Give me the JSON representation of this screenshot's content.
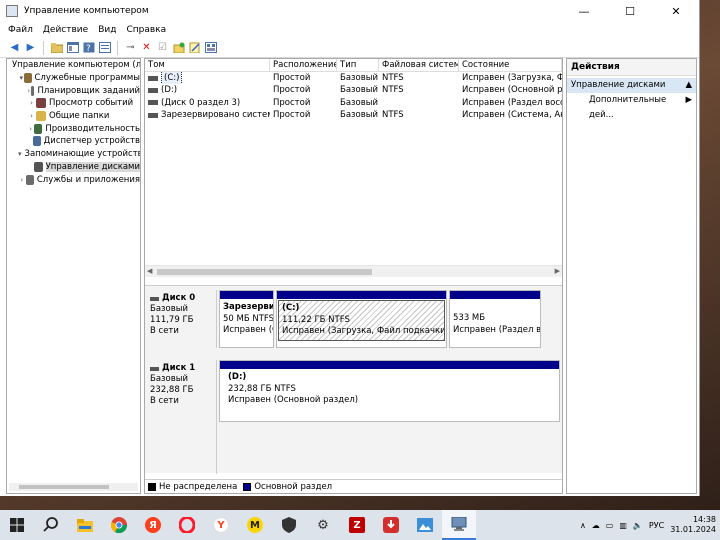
{
  "window": {
    "title": "Управление компьютером",
    "controls": [
      "—",
      "☐",
      "✕"
    ]
  },
  "menu": [
    "Файл",
    "Действие",
    "Вид",
    "Справка"
  ],
  "tree": {
    "items": [
      {
        "label": "Управление компьютером (лс",
        "indent": 0,
        "arrow": "",
        "color": "#5a7fa8"
      },
      {
        "label": "Служебные программы",
        "indent": 1,
        "arrow": "▾",
        "color": "#8a6d3b"
      },
      {
        "label": "Планировщик заданий",
        "indent": 2,
        "arrow": "›",
        "color": "#6b6b6b"
      },
      {
        "label": "Просмотр событий",
        "indent": 2,
        "arrow": "›",
        "color": "#7a3f3f"
      },
      {
        "label": "Общие папки",
        "indent": 2,
        "arrow": "›",
        "color": "#d8b24a"
      },
      {
        "label": "Производительность",
        "indent": 2,
        "arrow": "›",
        "color": "#3f6b3f"
      },
      {
        "label": "Диспетчер устройств",
        "indent": 2,
        "arrow": "",
        "color": "#4a6a9a"
      },
      {
        "label": "Запоминающие устройств",
        "indent": 1,
        "arrow": "▾",
        "color": "#6b6b6b"
      },
      {
        "label": "Управление дисками",
        "indent": 2,
        "arrow": "",
        "color": "#555555",
        "selected": true
      },
      {
        "label": "Службы и приложения",
        "indent": 1,
        "arrow": "›",
        "color": "#6b6b6b"
      }
    ]
  },
  "volumes": {
    "headers": [
      "Том",
      "Расположение",
      "Тип",
      "Файловая система",
      "Состояние"
    ],
    "rows": [
      {
        "name": "(C:)",
        "layout": "Простой",
        "type": "Базовый",
        "fs": "NTFS",
        "status": "Исправен (Загрузка, Файл",
        "selected": true
      },
      {
        "name": "(D:)",
        "layout": "Простой",
        "type": "Базовый",
        "fs": "NTFS",
        "status": "Исправен (Основной разде"
      },
      {
        "name": "(Диск 0 раздел 3)",
        "layout": "Простой",
        "type": "Базовый",
        "fs": "",
        "status": "Исправен (Раздел восстан"
      },
      {
        "name": "Зарезервировано системой",
        "layout": "Простой",
        "type": "Базовый",
        "fs": "NTFS",
        "status": "Исправен (Система, Актив"
      }
    ]
  },
  "disks": [
    {
      "name": "Диск 0",
      "type": "Базовый",
      "size": "111,79 ГБ",
      "state": "В сети",
      "partitions": [
        {
          "title": "Зарезервир",
          "line2": "50 МБ NTFS",
          "line3": "Исправен (С"
        },
        {
          "title": "(C:)",
          "line2": "111,22 ГБ NTFS",
          "line3": "Исправен (Загрузка, Файл подкачки, Авар"
        },
        {
          "title": "",
          "line2": "533 МБ",
          "line3": "Исправен (Раздел вос"
        }
      ]
    },
    {
      "name": "Диск 1",
      "type": "Базовый",
      "size": "232,88 ГБ",
      "state": "В сети",
      "partitions": [
        {
          "title": "(D:)",
          "line2": "232,88 ГБ NTFS",
          "line3": "Исправен (Основной раздел)"
        }
      ]
    }
  ],
  "legend": {
    "unallocated": "Не распределена",
    "primary": "Основной раздел",
    "unallocated_color": "#000000",
    "primary_color": "#00008b"
  },
  "actions": {
    "header": "Действия",
    "section": "Управление дисками",
    "section_arrow": "▲",
    "item": "Дополнительные дей...",
    "item_arrow": "▶"
  },
  "taskbar": {
    "lang": "РУС",
    "time": "14:38",
    "date": "31.01.2024"
  }
}
